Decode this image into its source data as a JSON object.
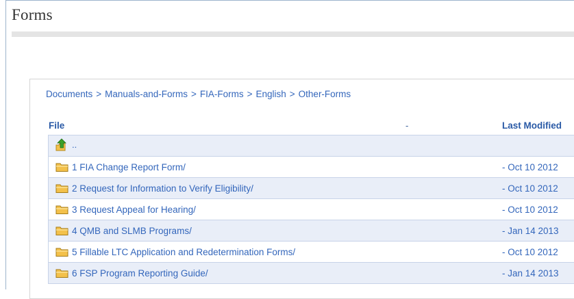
{
  "page": {
    "title": "Forms"
  },
  "breadcrumb": [
    "Documents",
    "Manuals-and-Forms",
    "FIA-Forms",
    "English",
    "Other-Forms"
  ],
  "breadcrumb_separator": ">",
  "table": {
    "headers": {
      "file": "File",
      "dash": "-",
      "last_modified": "Last Modified"
    },
    "parent_row": {
      "label": "..",
      "icon": "folder-up-icon"
    },
    "rows": [
      {
        "name": "1 FIA Change Report Form/",
        "date": "- Oct 10 2012",
        "icon": "folder-icon"
      },
      {
        "name": "2 Request for Information to Verify Eligibility/",
        "date": "- Oct 10 2012",
        "icon": "folder-icon"
      },
      {
        "name": "3 Request Appeal for Hearing/",
        "date": "- Oct 10 2012",
        "icon": "folder-icon"
      },
      {
        "name": "4 QMB and SLMB Programs/",
        "date": "- Jan 14 2013",
        "icon": "folder-icon"
      },
      {
        "name": "5 Fillable LTC Application and Redetermination Forms/",
        "date": "- Oct 10 2012",
        "icon": "folder-icon"
      },
      {
        "name": "6 FSP Program Reporting Guide/",
        "date": "- Jan 14 2013",
        "icon": "folder-icon"
      }
    ]
  },
  "colors": {
    "link": "#3366bb",
    "row_shade": "#e9eef8",
    "folder": "#f3c14b",
    "up_arrow": "#3aa12a"
  }
}
